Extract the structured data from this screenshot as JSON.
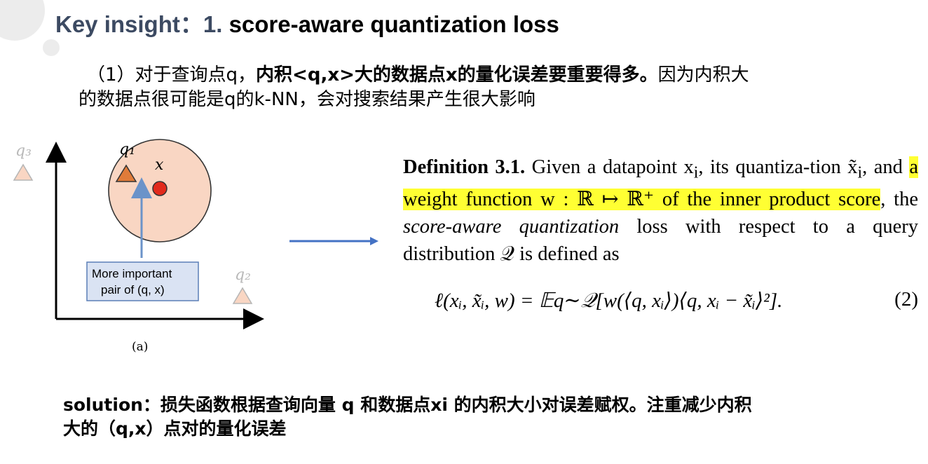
{
  "title": {
    "prefix": "Key insight：1. ",
    "main": "score-aware quantization loss"
  },
  "intro": {
    "part1": "（1）对于查询点q，",
    "bold": "内积<q,x>大的数据点x的量化误差要重要得多。",
    "part2": "因为内积大",
    "line2": "的数据点很可能是q的k-NN，会对搜索结果产生很大影响"
  },
  "figure": {
    "q3_label": "q₃",
    "q1_label": "q₁",
    "x_label": "x",
    "q2_label": "q₂",
    "box_line1": "More important",
    "box_line2": "pair of (q, x)",
    "caption": "(a)"
  },
  "definition": {
    "heading": "Definition 3.1.",
    "text1": " Given a datapoint x",
    "text1b": ", its quantiza-tion x̃",
    "text2": ", and ",
    "highlight": "a weight function w : ℝ ↦ ℝ⁺ of the inner product score",
    "text3": ", the ",
    "italic": "score-aware quantization",
    "text4": " loss with respect to a query distribution 𝒬 is defined as",
    "equation": "ℓ(xᵢ, x̃ᵢ, w) = 𝔼q∼𝒬[w(⟨q, xᵢ⟩)⟨q, xᵢ − x̃ᵢ⟩²].",
    "equation_number": "(2)"
  },
  "solution": {
    "line1": "solution：损失函数根据查询向量 q 和数据点xi 的内积大小对误差赋权。注重减少内积",
    "line2": "大的（q,x）点对的量化误差"
  },
  "colors": {
    "title_prefix": "#3c4a62",
    "highlight": "#ffff33",
    "circle_fill": "#f9d6c3",
    "arrow": "#4472c4"
  }
}
